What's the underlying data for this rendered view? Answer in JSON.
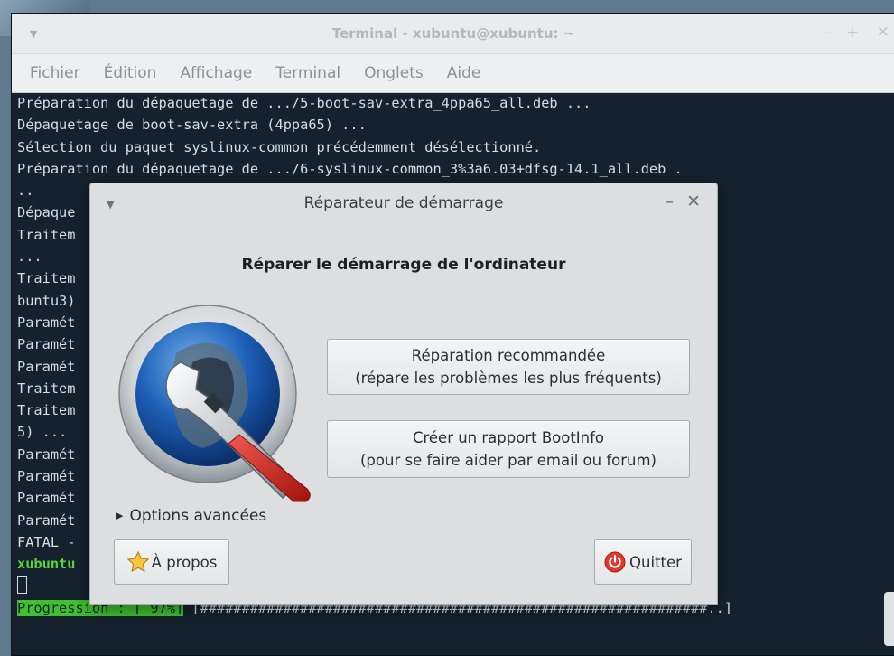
{
  "terminal": {
    "title": "Terminal - xubuntu@xubuntu: ~",
    "menu": [
      "Fichier",
      "Édition",
      "Affichage",
      "Terminal",
      "Onglets",
      "Aide"
    ],
    "lines": [
      "Préparation du dépaquetage de .../5-boot-sav-extra_4ppa65_all.deb ...",
      "Dépaquetage de boot-sav-extra (4ppa65) ...",
      "Sélection du paquet syslinux-common précédemment désélectionné.",
      "Préparation du dépaquetage de .../6-syslinux-common_3%3a6.03+dfsg-14.1_all.deb .",
      "..",
      "Dépaque",
      "Traitem                                                              (3.60ubuntu1)",
      "...",
      "Traitem                                                             e-utils (0.23-1u",
      "buntu3)",
      "Paramét",
      "Paramét",
      "Paramét",
      "Traitem                                                             6.1-2) ...",
      "Traitem                                                             (3.13.3-6ubuntu",
      "5) ...",
      "Paramét",
      "Paramét",
      "Paramét",
      "Paramét",
      "FATAL -"
    ],
    "prompt": "xubuntu",
    "progress_label": "Progression : [ 97%]",
    "progress_bar": " [#############################################################..]",
    "progress_percent": 97
  },
  "dialog": {
    "title": "Réparateur de démarrage",
    "heading": "Réparer le démarrage de l'ordinateur",
    "repair_button": {
      "line1": "Réparation recommandée",
      "line2": "(répare les problèmes les plus fréquents)"
    },
    "bootinfo_button": {
      "line1": "Créer un rapport BootInfo",
      "line2": "(pour se faire aider par email ou forum)"
    },
    "advanced_options": "Options avancées",
    "about_button": "À propos",
    "quit_button": "Quitter"
  },
  "colors": {
    "terminal_bg": "#15222d",
    "prompt_green": "#59d43a",
    "progress_green": "#3fc02e",
    "quit_red": "#e03a2e"
  },
  "icons": {
    "logo": "boot-repair-logo",
    "about": "star-icon",
    "quit": "power-icon"
  }
}
